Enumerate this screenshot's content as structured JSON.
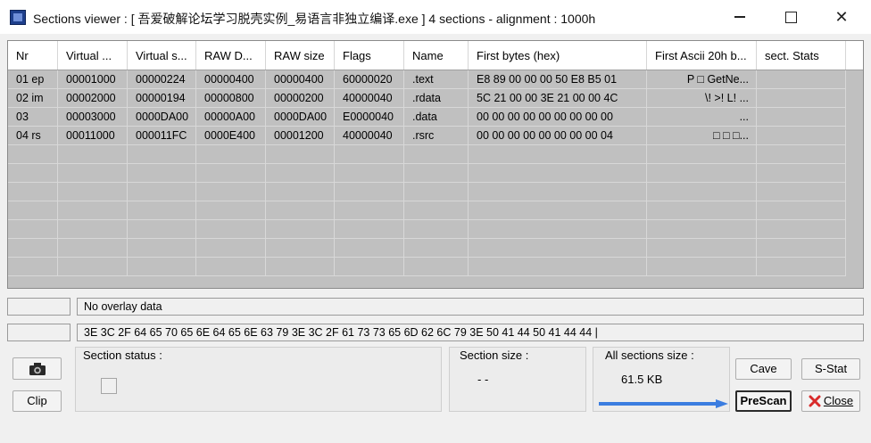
{
  "window": {
    "title": "Sections viewer : [ 吾爱破解论坛学习脱壳实例_易语言非独立编译.exe ] 4 sections - alignment : 1000h",
    "min_glyph": "",
    "close_glyph": "✕"
  },
  "table": {
    "columns": [
      "Nr",
      "Virtual ...",
      "Virtual s...",
      "RAW D...",
      "RAW size",
      "Flags",
      "Name",
      "First bytes (hex)",
      "First Ascii 20h b...",
      "sect. Stats"
    ],
    "rows": [
      [
        "01 ep",
        "00001000",
        "00000224",
        "00000400",
        "00000400",
        "60000020",
        ".text",
        "E8 89 00 00 00 50 E8 B5 01",
        "P  □  GetNe...",
        ""
      ],
      [
        "02 im",
        "00002000",
        "00000194",
        "00000800",
        "00000200",
        "40000040",
        ".rdata",
        "5C 21 00 00 3E 21 00 00 4C",
        "\\!  >!  L!        ...",
        ""
      ],
      [
        "03",
        "00003000",
        "0000DA00",
        "00000A00",
        "0000DA00",
        "E0000040",
        ".data",
        "00 00 00 00 00 00 00 00 00",
        "...",
        ""
      ],
      [
        "04 rs",
        "00011000",
        "000011FC",
        "0000E400",
        "00001200",
        "40000040",
        ".rsrc",
        "00 00 00 00 00 00 00 00 04",
        "□    □ □...",
        ""
      ]
    ]
  },
  "overlay": {
    "text": "No overlay data"
  },
  "bytes_line": {
    "text": "3E 3C 2F 64 65 70 65 6E 64 65 6E 63 79 3E 3C 2F 61 73 73 65 6D 62 6C 79 3E 50 41 44 50 41 44 44   |"
  },
  "section_status": {
    "label": "Section status :"
  },
  "section_size": {
    "label": "Section size :",
    "value": "- -"
  },
  "all_sections": {
    "label": "All sections size :",
    "value": "61.5 KB"
  },
  "buttons": {
    "clip": "Clip",
    "cave": "Cave",
    "sstat": "S-Stat",
    "prescan": "PreScan",
    "close": "Close"
  },
  "colors": {
    "accent_arrow": "#3b7de0",
    "close_x": "#d92b2b",
    "table_bg": "#c0c0c0"
  },
  "icons": [
    "app-icon",
    "camera-icon",
    "close-x-icon",
    "right-arrow-icon"
  ]
}
